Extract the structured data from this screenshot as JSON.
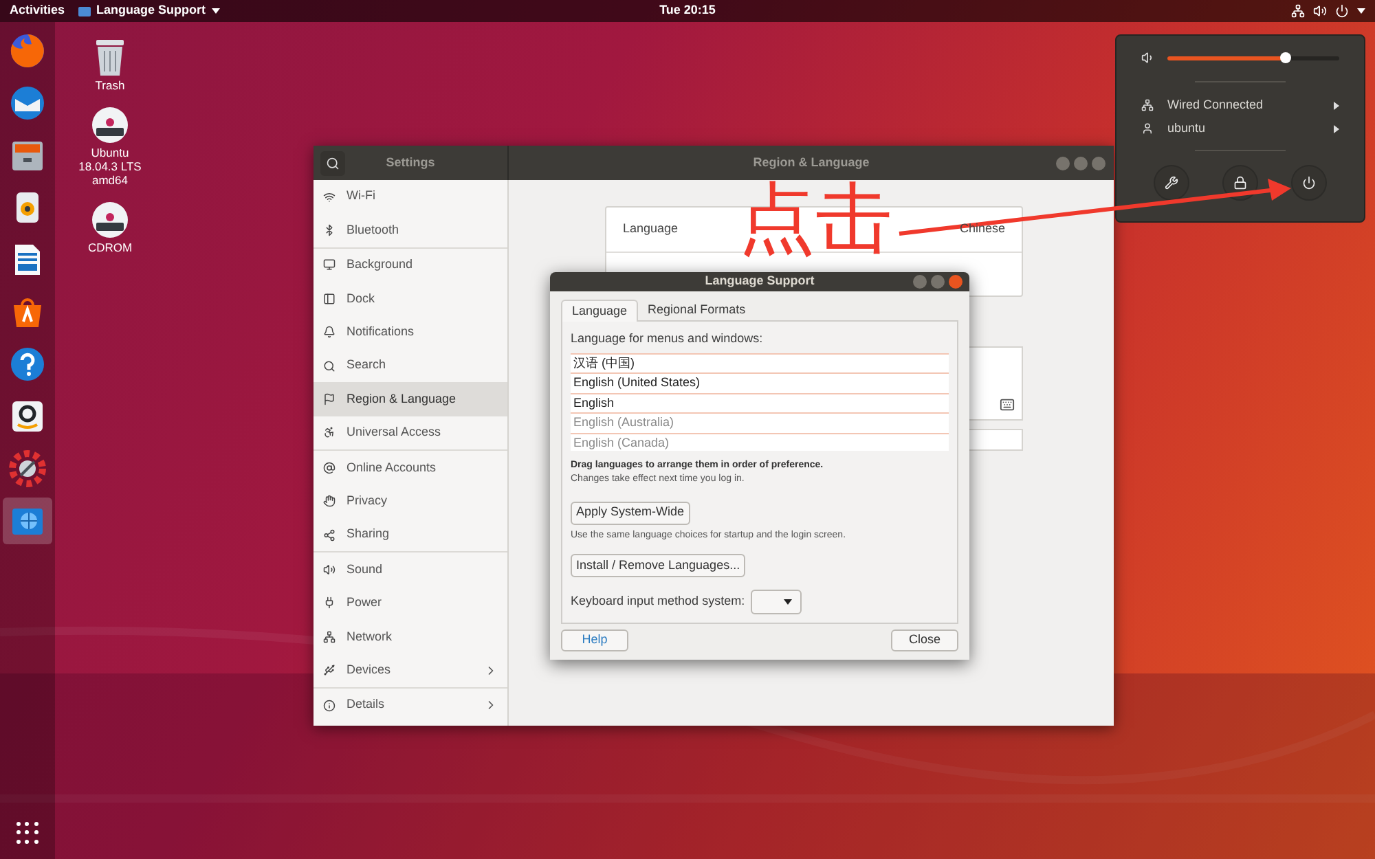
{
  "top_bar": {
    "activities": "Activities",
    "app_menu": "Language Support",
    "clock": "Tue 20:15"
  },
  "dock": {
    "apps": [
      {
        "kind": "firefox",
        "selected": false
      },
      {
        "kind": "mail",
        "selected": false
      },
      {
        "kind": "files",
        "selected": false
      },
      {
        "kind": "music",
        "selected": false
      },
      {
        "kind": "writer",
        "selected": false
      },
      {
        "kind": "software",
        "selected": false
      },
      {
        "kind": "help",
        "selected": false
      },
      {
        "kind": "amazon",
        "selected": false
      },
      {
        "kind": "updater",
        "selected": false
      },
      {
        "kind": "language",
        "selected": true
      }
    ]
  },
  "desktop_icons": [
    {
      "kind": "trash",
      "label_lines": [
        "Trash"
      ]
    },
    {
      "kind": "disc",
      "label_lines": [
        "Ubuntu",
        "18.04.3 LTS",
        "amd64"
      ]
    },
    {
      "kind": "disc",
      "label_lines": [
        "CDROM"
      ]
    }
  ],
  "settings": {
    "search_title": "Settings",
    "title": "Region & Language",
    "sidebar_groups": [
      [
        {
          "kind": "wifi",
          "label": "Wi-Fi",
          "selected": false,
          "has_arrow": false
        },
        {
          "kind": "bluetooth",
          "label": "Bluetooth",
          "selected": false,
          "has_arrow": false
        }
      ],
      [
        {
          "kind": "background",
          "label": "Background",
          "selected": false,
          "has_arrow": false
        },
        {
          "kind": "dock",
          "label": "Dock",
          "selected": false,
          "has_arrow": false
        },
        {
          "kind": "notifications",
          "label": "Notifications",
          "selected": false,
          "has_arrow": false
        },
        {
          "kind": "search",
          "label": "Search",
          "selected": false,
          "has_arrow": false
        },
        {
          "kind": "region",
          "label": "Region & Language",
          "selected": true,
          "has_arrow": false
        },
        {
          "kind": "access",
          "label": "Universal Access",
          "selected": false,
          "has_arrow": false
        }
      ],
      [
        {
          "kind": "accounts",
          "label": "Online Accounts",
          "selected": false,
          "has_arrow": false
        },
        {
          "kind": "privacy",
          "label": "Privacy",
          "selected": false,
          "has_arrow": false
        },
        {
          "kind": "sharing",
          "label": "Sharing",
          "selected": false,
          "has_arrow": false
        }
      ],
      [
        {
          "kind": "sound",
          "label": "Sound",
          "selected": false,
          "has_arrow": false
        },
        {
          "kind": "power",
          "label": "Power",
          "selected": false,
          "has_arrow": false
        },
        {
          "kind": "network",
          "label": "Network",
          "selected": false,
          "has_arrow": false
        },
        {
          "kind": "devices",
          "label": "Devices",
          "selected": false,
          "has_arrow": true
        }
      ],
      [
        {
          "kind": "details",
          "label": "Details",
          "selected": false,
          "has_arrow": true
        }
      ]
    ],
    "rows": [
      {
        "label": "Language",
        "value": "Chinese"
      }
    ]
  },
  "language_support": {
    "title": "Language Support",
    "tabs": [
      {
        "label": "Language",
        "selected": true
      },
      {
        "label": "Regional Formats",
        "selected": false
      }
    ],
    "list_label": "Language for menus and windows:",
    "languages": [
      {
        "name": "汉语 (中国)",
        "dimmed": false
      },
      {
        "name": "English (United States)",
        "dimmed": false
      },
      {
        "name": "English",
        "dimmed": false
      },
      {
        "name": "English (Australia)",
        "dimmed": true
      },
      {
        "name": "English (Canada)",
        "dimmed": true
      }
    ],
    "hint_bold": "Drag languages to arrange them in order of preference.",
    "hint": "Changes take effect next time you log in.",
    "apply_button": "Apply System-Wide",
    "apply_note": "Use the same language choices for startup and the login screen.",
    "install_button": "Install / Remove Languages...",
    "keyboard_label": "Keyboard input method system:",
    "help_button": "Help",
    "close_button": "Close"
  },
  "system_menu": {
    "volume": {
      "level": 0.69
    },
    "items": [
      {
        "kind": "network",
        "label": "Wired Connected"
      },
      {
        "kind": "user",
        "label": "ubuntu"
      }
    ]
  },
  "annotation": {
    "text": "点击"
  }
}
